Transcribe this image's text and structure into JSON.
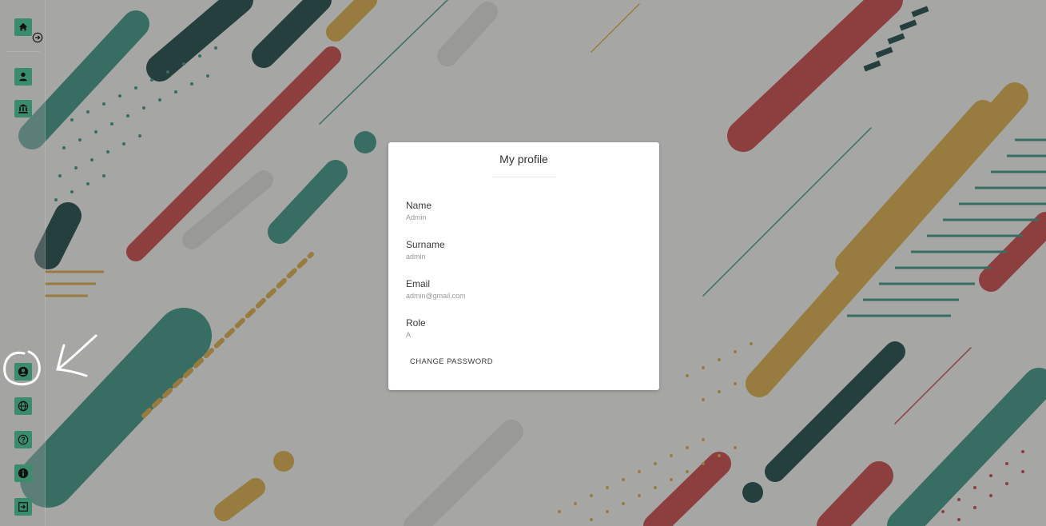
{
  "icons": {
    "home": "home-icon",
    "expand": "arrow-right-circle-icon",
    "user": "user-icon",
    "institution": "bank-icon",
    "profile": "user-circle-icon",
    "language": "globe-icon",
    "help": "question-circle-icon",
    "info": "info-circle-icon",
    "logout": "sign-out-icon"
  },
  "colors": {
    "sidebar_accent": "#3b8b6d",
    "card_background": "#ffffff",
    "bg_teal": "#2e8a79",
    "bg_red": "#c13a3a",
    "bg_gold": "#d4a43b",
    "bg_dark": "#0f3a3a"
  },
  "profile": {
    "title": "My profile",
    "fields": [
      {
        "label": "Name",
        "value": "Admin"
      },
      {
        "label": "Surname",
        "value": "admin"
      },
      {
        "label": "Email",
        "value": "admin@gmail.com"
      },
      {
        "label": "Role",
        "value": "A"
      }
    ],
    "change_password_label": "CHANGE PASSWORD"
  }
}
